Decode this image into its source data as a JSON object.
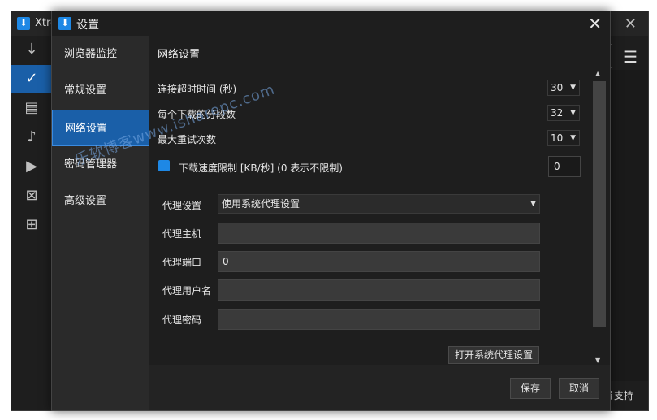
{
  "bg_window": {
    "title": "Xtre",
    "support_text": "寻支持",
    "colors": {
      "selected": "#1a5fa8"
    }
  },
  "dialog": {
    "title": "设置",
    "nav": [
      {
        "label": "浏览器监控"
      },
      {
        "label": "常规设置"
      },
      {
        "label": "网络设置",
        "active": true
      },
      {
        "label": "密码管理器"
      },
      {
        "label": "高级设置"
      }
    ],
    "section_title": "网络设置",
    "connection_timeout": {
      "label": "连接超时时间 (秒)",
      "value": "30"
    },
    "segments": {
      "label": "每个下载的分段数",
      "value": "32"
    },
    "max_retries": {
      "label": "最大重试次数",
      "value": "10"
    },
    "speed_limit": {
      "label": "下载速度限制 [KB/秒] (0 表示不限制)",
      "value": "0",
      "checked": true
    },
    "proxy": {
      "mode_label": "代理设置",
      "mode_value": "使用系统代理设置",
      "host_label": "代理主机",
      "host_value": "",
      "port_label": "代理端口",
      "port_value": "0",
      "user_label": "代理用户名",
      "user_value": "",
      "password_label": "代理密码",
      "password_value": "",
      "open_system_button": "打开系统代理设置"
    },
    "save_button": "保存",
    "cancel_button": "取消"
  },
  "watermark": "乐软博客www.isharepc.com",
  "accent_color": "#1e88e5"
}
